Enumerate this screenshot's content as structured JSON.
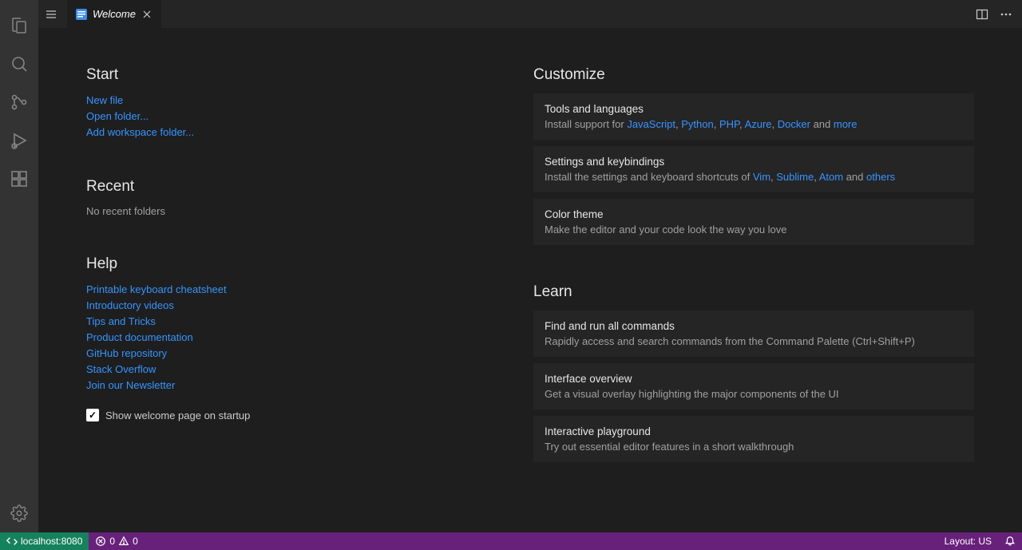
{
  "tab": {
    "title": "Welcome"
  },
  "start": {
    "heading": "Start",
    "links": [
      "New file",
      "Open folder...",
      "Add workspace folder..."
    ]
  },
  "recent": {
    "heading": "Recent",
    "empty": "No recent folders"
  },
  "help": {
    "heading": "Help",
    "links": [
      "Printable keyboard cheatsheet",
      "Introductory videos",
      "Tips and Tricks",
      "Product documentation",
      "GitHub repository",
      "Stack Overflow",
      "Join our Newsletter"
    ]
  },
  "showOnStartup": "Show welcome page on startup",
  "customize": {
    "heading": "Customize",
    "cards": {
      "tools": {
        "title": "Tools and languages",
        "prefix": "Install support for ",
        "links": [
          "JavaScript",
          "Python",
          "PHP",
          "Azure",
          "Docker"
        ],
        "and": " and ",
        "more": "more"
      },
      "settings": {
        "title": "Settings and keybindings",
        "prefix": "Install the settings and keyboard shortcuts of ",
        "links": [
          "Vim",
          "Sublime",
          "Atom"
        ],
        "and": " and ",
        "others": "others"
      },
      "theme": {
        "title": "Color theme",
        "desc": "Make the editor and your code look the way you love"
      }
    }
  },
  "learn": {
    "heading": "Learn",
    "cards": [
      {
        "title": "Find and run all commands",
        "desc": "Rapidly access and search commands from the Command Palette (Ctrl+Shift+P)"
      },
      {
        "title": "Interface overview",
        "desc": "Get a visual overlay highlighting the major components of the UI"
      },
      {
        "title": "Interactive playground",
        "desc": "Try out essential editor features in a short walkthrough"
      }
    ]
  },
  "status": {
    "remote": "localhost:8080",
    "errors": "0",
    "warnings": "0",
    "layout": "Layout: US"
  }
}
